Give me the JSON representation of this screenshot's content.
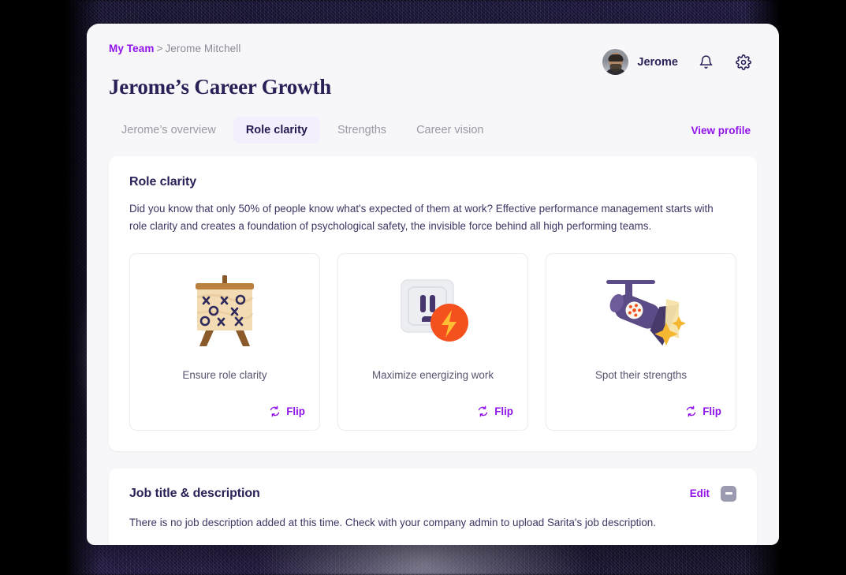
{
  "header": {
    "breadcrumb": {
      "link": "My Team",
      "separator": ">",
      "current": "Jerome Mitchell"
    },
    "page_title": "Jerome’s Career Growth",
    "user_name": "Jerome",
    "bell_icon": "notification-bell-icon",
    "gear_icon": "settings-gear-icon",
    "avatar_icon": "user-avatar-photo"
  },
  "tabs": [
    {
      "label": "Jerome’s overview",
      "active": false
    },
    {
      "label": "Role clarity",
      "active": true
    },
    {
      "label": "Strengths",
      "active": false
    },
    {
      "label": "Career vision",
      "active": false
    }
  ],
  "view_profile_label": "View profile",
  "role_clarity": {
    "title": "Role clarity",
    "description": "Did you know that only 50% of people know what's expected of them at work? Effective performance management starts with role clarity and creates a foundation of psychological safety, the invisible force behind all high performing teams.",
    "cards": [
      {
        "label": "Ensure role clarity",
        "flip_label": "Flip",
        "art": "easel-strategy-board-icon"
      },
      {
        "label": "Maximize energizing work",
        "flip_label": "Flip",
        "art": "power-outlet-lightning-icon"
      },
      {
        "label": "Spot their strengths",
        "flip_label": "Flip",
        "art": "spotlight-sparkles-icon"
      }
    ]
  },
  "job_section": {
    "title": "Job title & description",
    "edit_label": "Edit",
    "collapse_icon": "collapse-minus-icon",
    "description": "There is no job description added at this time. Check with your company admin to upload Sarita's job description."
  },
  "colors": {
    "accent_purple": "#9013ec",
    "title_navy": "#2a1f56",
    "tab_active_bg": "#f4effd",
    "page_bg": "#f7f7f9",
    "orange": "#f4511e"
  }
}
